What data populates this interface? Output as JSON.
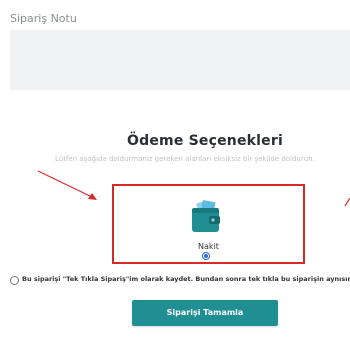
{
  "order_note": {
    "label": "Sipariş Notu",
    "value": ""
  },
  "payment": {
    "title": "Ödeme Seçenekleri",
    "subtitle": "Lütfen aşağıda doldurmanız gereken alanları eksiksiz bir şekilde doldurun.",
    "options": [
      {
        "label": "Nakit",
        "icon": "cash-wallet-icon",
        "selected": true
      }
    ]
  },
  "one_click": {
    "checked": false,
    "label": "Bu siparişi \"Tek Tıkla Sipariş\"im olarak kaydet. Bundan sonra tek tıkla bu siparişin aynısını vermek isti"
  },
  "actions": {
    "complete_label": "Siparişi Tamamla"
  },
  "colors": {
    "accent": "#1f8f93",
    "highlight": "#d92a2a",
    "radio": "#2a6bd6"
  }
}
